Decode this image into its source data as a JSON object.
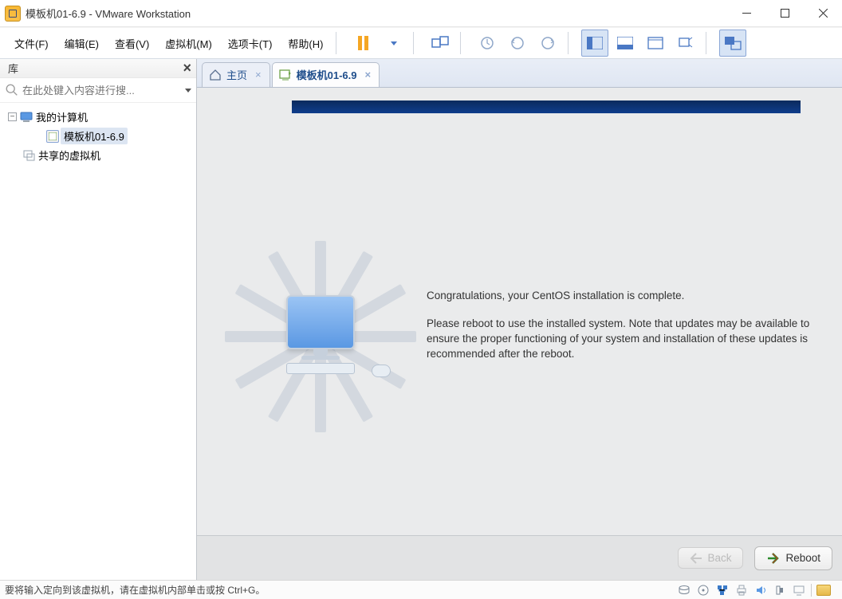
{
  "title": "模板机01-6.9 - VMware Workstation",
  "menu": {
    "file": "文件(F)",
    "edit": "编辑(E)",
    "view": "查看(V)",
    "vm": "虚拟机(M)",
    "tabs": "选项卡(T)",
    "help": "帮助(H)"
  },
  "library": {
    "header": "库",
    "search_placeholder": "在此处键入内容进行搜..."
  },
  "tree": {
    "my_computer": "我的计算机",
    "vm_name": "模板机01-6.9",
    "shared": "共享的虚拟机"
  },
  "tabs": {
    "home": "主页",
    "vm": "模板机01-6.9"
  },
  "installer": {
    "congrats": "Congratulations, your CentOS installation is complete.",
    "reboot_msg": "Please reboot to use the installed system.  Note that updates may be available to ensure the proper functioning of your system and installation of these updates is recommended after the reboot.",
    "back": "Back",
    "reboot": "Reboot"
  },
  "status": "要将输入定向到该虚拟机，请在虚拟机内部单击或按 Ctrl+G。"
}
